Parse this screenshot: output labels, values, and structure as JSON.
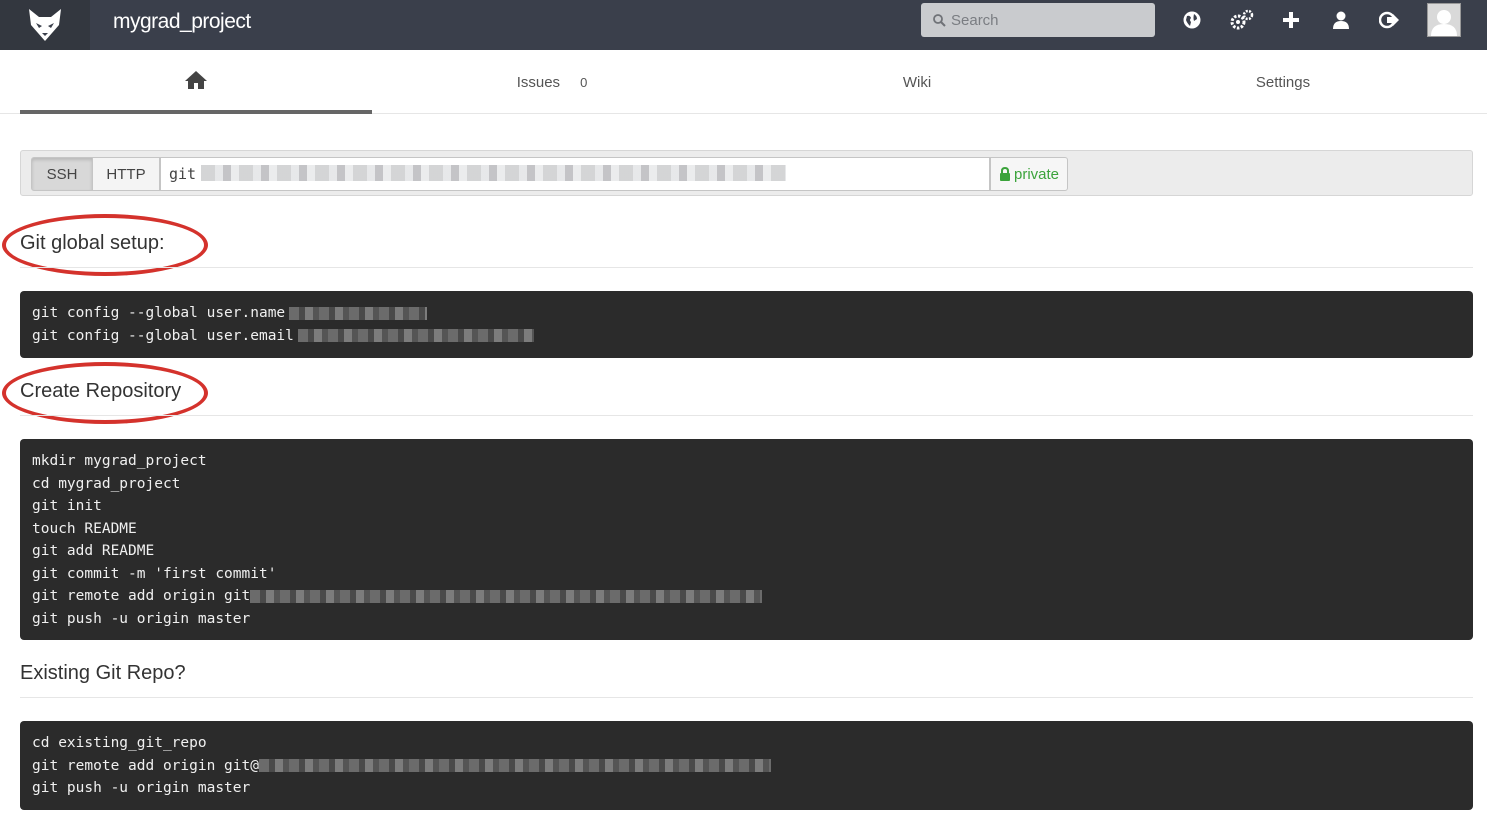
{
  "header": {
    "project_name": "mygrad_project",
    "search_placeholder": "Search",
    "icons": [
      "globe-icon",
      "cogs-icon",
      "plus-icon",
      "user-icon",
      "sign-out-icon"
    ]
  },
  "tabs": {
    "home_icon": "home-icon",
    "issues_label": "Issues",
    "issues_count": "0",
    "wiki_label": "Wiki",
    "settings_label": "Settings"
  },
  "clone": {
    "ssh_label": "SSH",
    "http_label": "HTTP",
    "url_prefix": "git",
    "private_label": "private"
  },
  "sections": {
    "global_setup_title": "Git global setup:",
    "global_setup_lines": [
      "git config --global user.name",
      "git config --global user.email"
    ],
    "create_repo_title": "Create Repository",
    "create_repo_lines": [
      "mkdir mygrad_project",
      "cd mygrad_project",
      "git init",
      "touch README",
      "git add README",
      "git commit -m 'first commit'",
      "git remote add origin git",
      "git push -u origin master"
    ],
    "existing_repo_title": "Existing Git Repo?",
    "existing_repo_lines": [
      "cd existing_git_repo",
      "git remote add origin git@",
      "git push -u origin master"
    ]
  },
  "colors": {
    "topbar": "#3a3f4b",
    "code_bg": "#2b2b2b",
    "private_green": "#3ba33b",
    "annotation_red": "#d4322c"
  }
}
